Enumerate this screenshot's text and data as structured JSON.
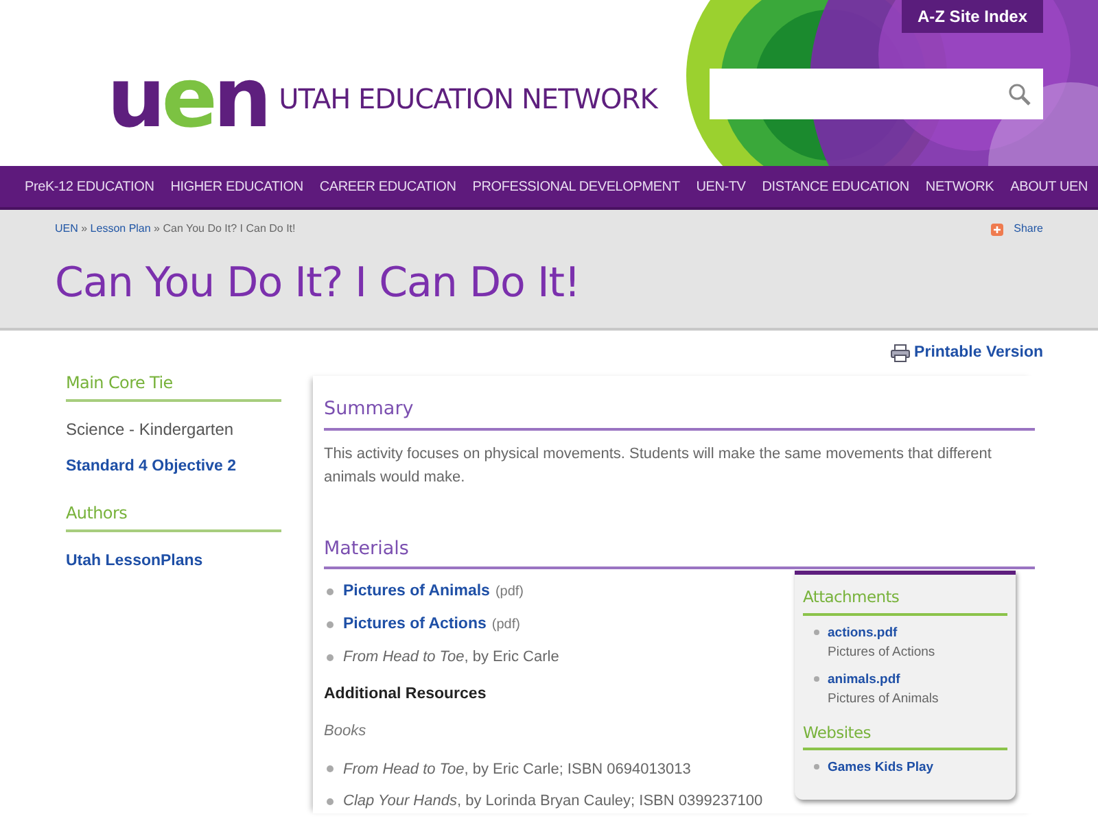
{
  "header": {
    "logo": "uen",
    "site_name": "UTAH EDUCATION NETWORK",
    "site_index_button": "A-Z Site Index"
  },
  "nav": [
    "PreK-12 EDUCATION",
    "HIGHER EDUCATION",
    "CAREER EDUCATION",
    "PROFESSIONAL DEVELOPMENT",
    "UEN-TV",
    "DISTANCE EDUCATION",
    "NETWORK",
    "ABOUT UEN"
  ],
  "breadcrumb": [
    {
      "label": "UEN",
      "link": true
    },
    {
      "label": "Lesson Plan",
      "link": true
    },
    {
      "label": "Can You Do It? I Can Do It!",
      "link": false
    }
  ],
  "breadcrumb_separator": "»",
  "share": "Share",
  "page_title": "Can You Do It? I Can Do It!",
  "printable_version": "Printable Version",
  "sidebar": [
    {
      "heading": "Main Core Tie",
      "items": [
        {
          "text": "Science - Kindergarten",
          "link": false
        },
        {
          "text": "Standard 4 Objective 2",
          "link": true
        }
      ]
    },
    {
      "heading": "Authors",
      "items": [
        {
          "text": "Utah LessonPlans",
          "link": true
        }
      ]
    }
  ],
  "summary": {
    "heading": "Summary",
    "text": "This activity focuses on physical movements. Students will make the same movements that different animals would make."
  },
  "materials": {
    "heading": "Materials",
    "items": [
      {
        "kind": "link",
        "text": "Pictures of Animals",
        "note": "(pdf)"
      },
      {
        "kind": "link",
        "text": "Pictures of Actions",
        "note": "(pdf)"
      },
      {
        "kind": "text",
        "text": "*From Head to Toe*, by Eric Carle"
      }
    ],
    "additional_heading": "Additional Resources",
    "books_label": "Books",
    "books": [
      "*From Head to Toe*, by Eric Carle; ISBN 0694013013",
      "*Clap Your Hands*, by Lorinda Bryan Cauley; ISBN 0399237100"
    ]
  },
  "aside": [
    {
      "heading": "Attachments",
      "items": [
        {
          "link": "actions.pdf",
          "description": "Pictures of Actions"
        },
        {
          "link": "animals.pdf",
          "description": "Pictures of Animals"
        }
      ]
    },
    {
      "heading": "Websites",
      "items": [
        {
          "link": "Games Kids Play"
        }
      ]
    }
  ]
}
